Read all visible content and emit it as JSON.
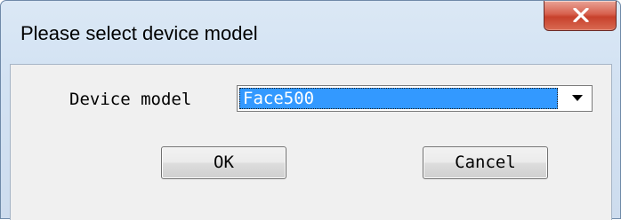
{
  "window": {
    "title": "Please select device model",
    "close_icon": "close-x-icon"
  },
  "form": {
    "device_model_label": "Device model",
    "device_model_value": "Face500",
    "dropdown_icon": "chevron-down-icon"
  },
  "buttons": {
    "ok_label": "OK",
    "cancel_label": "Cancel"
  },
  "colors": {
    "selection": "#3399ff",
    "close_button": "#c7412c",
    "titlebar": "#d4e3f3"
  }
}
